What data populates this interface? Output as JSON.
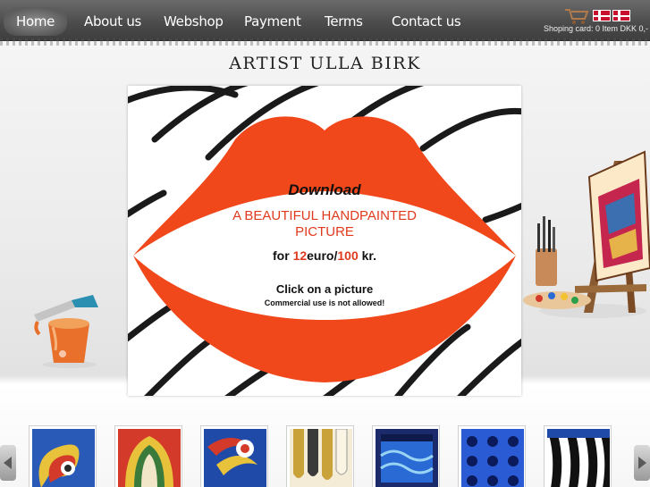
{
  "nav": {
    "items": [
      "Home",
      "About us",
      "Webshop",
      "Payment",
      "Terms",
      "Contact us"
    ],
    "active": "Home"
  },
  "cart": {
    "text": "Shoping card: 0 Item DKK 0,-",
    "icon": "shopping-cart-icon",
    "flags": [
      "danish-flag-icon",
      "danish-flag-icon"
    ]
  },
  "title": "ARTIST ULLA BIRK",
  "banner": {
    "download": "Download",
    "subtitle": "A BEAUTIFUL HANDPAINTED PICTURE",
    "price_for": "for",
    "price_euro": "12",
    "price_euro_unit": "euro/",
    "price_kr": "100",
    "price_kr_unit": "kr.",
    "click": "Click on a picture",
    "note": "Commercial use is not allowed!",
    "lip_color": "#f0471b",
    "accent_color": "#e03a1e"
  },
  "gallery": {
    "prev_icon": "arrow-left-icon",
    "next_icon": "arrow-right-icon",
    "thumbnails": [
      "painting-thumbnail",
      "painting-thumbnail",
      "painting-thumbnail",
      "painting-thumbnail",
      "painting-thumbnail",
      "painting-thumbnail",
      "painting-thumbnail"
    ]
  }
}
